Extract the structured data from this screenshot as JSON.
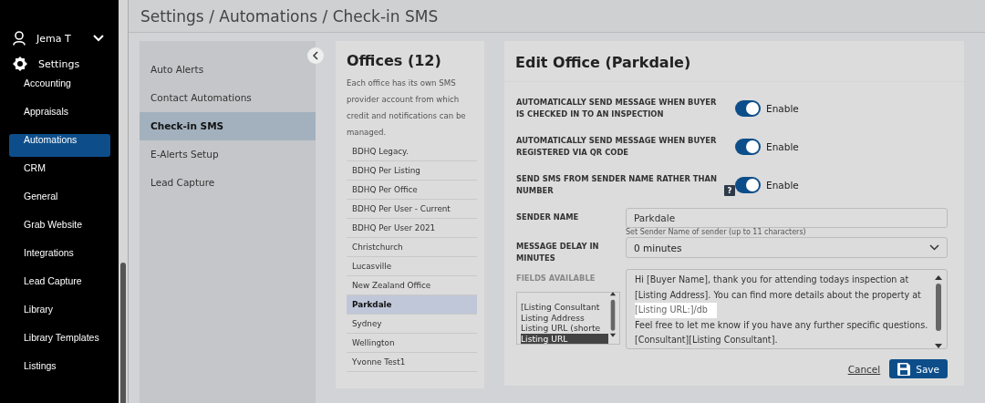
{
  "sidebar": {
    "user": "Jema T",
    "section": "Settings",
    "items": [
      {
        "label": "Accounting",
        "selected": false
      },
      {
        "label": "Appraisals",
        "selected": false
      },
      {
        "label": "Automations",
        "selected": true
      },
      {
        "label": "CRM",
        "selected": false
      },
      {
        "label": "General",
        "selected": false
      },
      {
        "label": "Grab Website",
        "selected": false
      },
      {
        "label": "Integrations",
        "selected": false
      },
      {
        "label": "Lead Capture",
        "selected": false
      },
      {
        "label": "Library",
        "selected": false
      },
      {
        "label": "Library Templates",
        "selected": false
      },
      {
        "label": "Listings",
        "selected": false
      }
    ]
  },
  "breadcrumb": "Settings / Automations / Check-in SMS",
  "subnav": {
    "items": [
      {
        "label": "Auto Alerts",
        "selected": false
      },
      {
        "label": "Contact Automations",
        "selected": false
      },
      {
        "label": "Check-in SMS",
        "selected": true
      },
      {
        "label": "E-Alerts Setup",
        "selected": false
      },
      {
        "label": "Lead Capture",
        "selected": false
      }
    ]
  },
  "offices": {
    "title": "Offices (12)",
    "description": "Each office has its own SMS provider account from which credit and notifications can be managed.",
    "items": [
      {
        "label": "BDHQ Legacy.",
        "selected": false
      },
      {
        "label": "BDHQ Per Listing",
        "selected": false
      },
      {
        "label": "BDHQ Per Office",
        "selected": false
      },
      {
        "label": "BDHQ Per User - Current",
        "selected": false
      },
      {
        "label": "BDHQ Per User 2021",
        "selected": false
      },
      {
        "label": "Christchurch",
        "selected": false
      },
      {
        "label": "Lucasville",
        "selected": false
      },
      {
        "label": "New Zealand Office",
        "selected": false
      },
      {
        "label": "Parkdale",
        "selected": true
      },
      {
        "label": "Sydney",
        "selected": false
      },
      {
        "label": "Wellington",
        "selected": false
      },
      {
        "label": "Yvonne Test1",
        "selected": false
      }
    ]
  },
  "edit": {
    "title": "Edit Office (Parkdale)",
    "toggles": [
      {
        "label": "AUTOMATICALLY SEND MESSAGE WHEN BUYER IS CHECKED IN TO AN INSPECTION",
        "on": true,
        "state_label": "Enable"
      },
      {
        "label": "AUTOMATICALLY SEND MESSAGE WHEN BUYER REGISTERED VIA QR CODE",
        "on": true,
        "state_label": "Enable"
      },
      {
        "label": "SEND SMS FROM SENDER NAME RATHER THAN NUMBER",
        "on": true,
        "help_icon": "?",
        "state_label": "Enable"
      }
    ],
    "sender_name": {
      "label": "SENDER NAME",
      "value": "Parkdale",
      "hint": "Set Sender Name of sender (up to 11 characters)"
    },
    "delay": {
      "label": "MESSAGE DELAY IN MINUTES",
      "value": "0 minutes"
    },
    "fields": {
      "label": "FIELDS AVAILABLE",
      "items": [
        {
          "label": "[Listing Consultant",
          "selected": false
        },
        {
          "label": "Listing Address",
          "selected": false
        },
        {
          "label": "Listing URL (shorte",
          "selected": false
        },
        {
          "label": "Listing URL",
          "selected": true
        }
      ]
    },
    "message": {
      "before": "Hi [Buyer Name], thank you for attending todays inspection at [Listing Address]. You can find more details about the property at",
      "highlighted": "[Listing URL:]/db",
      "after": "Feel free to let me know if you have any further specific questions. [Consultant][Listing Consultant]."
    },
    "cancel": "Cancel",
    "save": "Save"
  }
}
